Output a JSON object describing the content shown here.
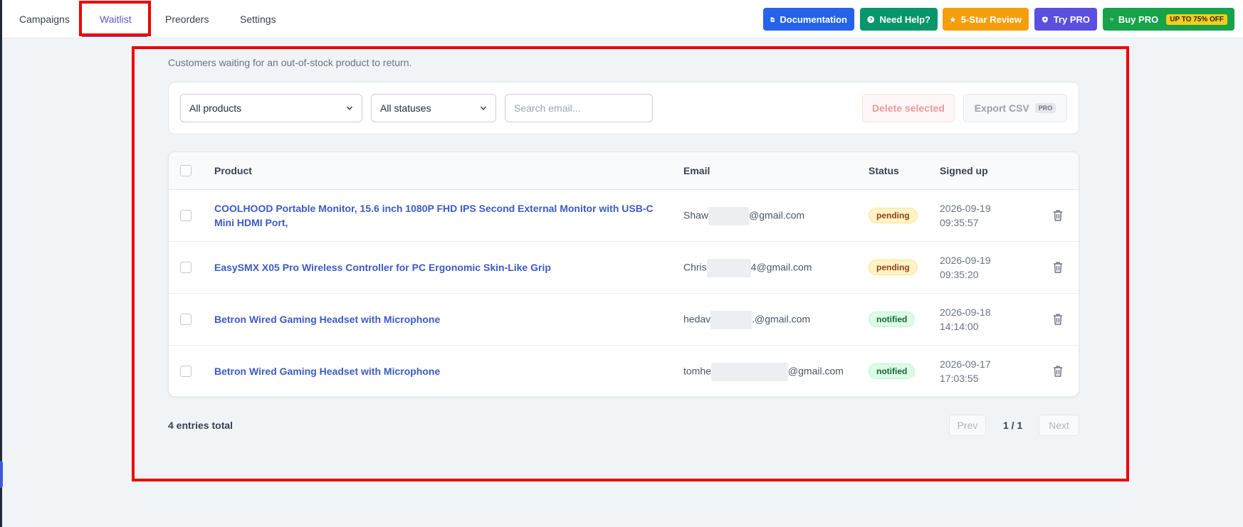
{
  "nav": {
    "tabs": [
      {
        "label": "Campaigns"
      },
      {
        "label": "Waitlist"
      },
      {
        "label": "Preorders"
      },
      {
        "label": "Settings"
      }
    ],
    "active_tab": "Waitlist",
    "buttons": {
      "documentation": "Documentation",
      "need_help": "Need Help?",
      "review": "5-Star Review",
      "try_pro": "Try PRO",
      "buy_pro": "Buy PRO",
      "buy_pro_badge": "UP TO 75% OFF"
    },
    "colors": {
      "documentation": "#2563eb",
      "need_help": "#059669",
      "review": "#f59e0b",
      "try_pro": "#5b4fe0",
      "buy_pro": "#16a34a"
    }
  },
  "main": {
    "subtitle": "Customers waiting for an out-of-stock product to return.",
    "filters": {
      "product_select": "All products",
      "status_select": "All statuses",
      "search_placeholder": "Search email...",
      "delete_label": "Delete selected",
      "export_label": "Export CSV",
      "export_badge": "PRO"
    },
    "table": {
      "headers": {
        "product": "Product",
        "email": "Email",
        "status": "Status",
        "signed_up": "Signed up"
      },
      "rows": [
        {
          "product": "COOLHOOD Portable Monitor, 15.6 inch 1080P FHD IPS Second External Monitor with USB-C Mini HDMI Port,",
          "email_prefix": "Shaw",
          "email_suffix": "@gmail.com",
          "status": "pending",
          "date": "2026-09-19",
          "time": "09:35:57"
        },
        {
          "product": "EasySMX X05 Pro Wireless Controller for PC Ergonomic Skin-Like Grip",
          "email_prefix": "Chris",
          "email_suffix": "4@gmail.com",
          "status": "pending",
          "date": "2026-09-19",
          "time": "09:35:20"
        },
        {
          "product": "Betron Wired Gaming Headset with Microphone",
          "email_prefix": "hedav",
          "email_suffix": ".@gmail.com",
          "status": "notified",
          "date": "2026-09-18",
          "time": "14:14:00"
        },
        {
          "product": "Betron Wired Gaming Headset with Microphone",
          "email_prefix": "tomhe",
          "email_suffix": "@gmail.com",
          "status": "notified",
          "date": "2026-09-17",
          "time": "17:03:55"
        }
      ]
    },
    "footer": {
      "total": "4 entries total",
      "prev": "Prev",
      "page": "1 / 1",
      "next": "Next"
    }
  }
}
